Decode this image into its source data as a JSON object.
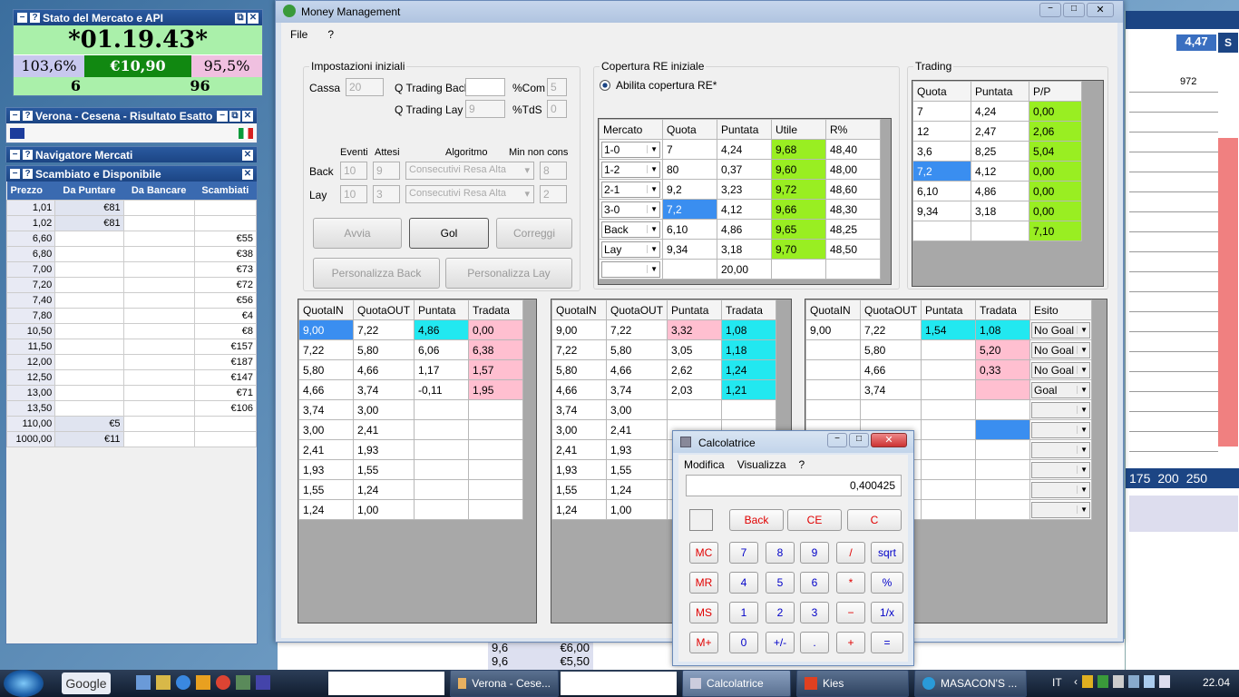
{
  "stato": {
    "title": "Stato del Mercato e API",
    "clock": "*01.19.43*",
    "left": "103,6%",
    "mid": "€10,90",
    "right": "95,5%",
    "n1": "6",
    "n2": "96"
  },
  "verona": {
    "title": "Verona - Cesena - Risultato Esatto"
  },
  "navigatore": {
    "title": "Navigatore Mercati"
  },
  "scambiato": {
    "title": "Scambiato e Disponibile",
    "headers": [
      "Prezzo",
      "Da Puntare",
      "Da Bancare",
      "Scambiati"
    ],
    "rows": [
      [
        "1,01",
        "€81",
        "",
        ""
      ],
      [
        "1,02",
        "€81",
        "",
        ""
      ],
      [
        "6,60",
        "",
        "",
        "€55"
      ],
      [
        "6,80",
        "",
        "",
        "€38"
      ],
      [
        "7,00",
        "",
        "",
        "€73"
      ],
      [
        "7,20",
        "",
        "",
        "€72"
      ],
      [
        "7,40",
        "",
        "",
        "€56"
      ],
      [
        "7,80",
        "",
        "",
        "€4"
      ],
      [
        "10,50",
        "",
        "",
        "€8"
      ],
      [
        "11,50",
        "",
        "",
        "€157"
      ],
      [
        "12,00",
        "",
        "",
        "€187"
      ],
      [
        "12,50",
        "",
        "",
        "€147"
      ],
      [
        "13,00",
        "",
        "",
        "€71"
      ],
      [
        "13,50",
        "",
        "",
        "€106"
      ],
      [
        "110,00",
        "€5",
        "",
        ""
      ],
      [
        "1000,00",
        "€11",
        "",
        ""
      ]
    ]
  },
  "mm": {
    "title": "Money Management",
    "menu": [
      "File",
      "?"
    ],
    "impostazioni": {
      "label": "Impostazioni iniziali",
      "cassa_label": "Cassa",
      "cassa": "20",
      "qtb_label": "Q Trading Back",
      "qtb": "",
      "com_label": "%Com",
      "com": "5",
      "qtl_label": "Q Trading Lay",
      "qtl": "9",
      "tds_label": "%TdS",
      "tds": "0",
      "eventi": "Eventi",
      "attesi": "Attesi",
      "algoritmo": "Algoritmo",
      "minnon": "Min non cons",
      "back": "Back",
      "lay": "Lay",
      "b_ev": "10",
      "b_at": "9",
      "b_alg": "Consecutivi Resa Alta",
      "b_min": "8",
      "l_ev": "10",
      "l_at": "3",
      "l_alg": "Consecutivi Resa Alta",
      "l_min": "2",
      "avvia": "Avvia",
      "gol": "Gol",
      "correggi": "Correggi",
      "pers_back": "Personalizza Back",
      "pers_lay": "Personalizza Lay"
    },
    "copertura": {
      "label": "Copertura RE iniziale",
      "radio": "Abilita copertura RE*",
      "headers": [
        "Mercato",
        "Quota",
        "Puntata",
        "Utile",
        "R%"
      ],
      "rows": [
        [
          "1-0",
          "7",
          "4,24",
          "9,68",
          "48,40"
        ],
        [
          "1-2",
          "80",
          "0,37",
          "9,60",
          "48,00"
        ],
        [
          "2-1",
          "9,2",
          "3,23",
          "9,72",
          "48,60"
        ],
        [
          "3-0",
          "7,2",
          "4,12",
          "9,66",
          "48,30"
        ],
        [
          "Back",
          "6,10",
          "4,86",
          "9,65",
          "48,25"
        ],
        [
          "Lay",
          "9,34",
          "3,18",
          "9,70",
          "48,50"
        ],
        [
          "",
          "",
          "20,00",
          "",
          ""
        ]
      ]
    },
    "trading": {
      "label": "Trading",
      "headers": [
        "Quota",
        "Puntata",
        "P/P"
      ],
      "rows": [
        [
          "7",
          "4,24",
          "0,00"
        ],
        [
          "12",
          "2,47",
          "2,06"
        ],
        [
          "3,6",
          "8,25",
          "5,04"
        ],
        [
          "7,2",
          "4,12",
          "0,00"
        ],
        [
          "6,10",
          "4,86",
          "0,00"
        ],
        [
          "9,34",
          "3,18",
          "0,00"
        ],
        [
          "",
          "",
          "7,10"
        ]
      ]
    },
    "t1": {
      "headers": [
        "QuotaIN",
        "QuotaOUT",
        "Puntata",
        "Tradata"
      ],
      "rows": [
        [
          "9,00",
          "7,22",
          "4,86",
          "0,00"
        ],
        [
          "7,22",
          "5,80",
          "6,06",
          "6,38"
        ],
        [
          "5,80",
          "4,66",
          "1,17",
          "1,57"
        ],
        [
          "4,66",
          "3,74",
          "-0,11",
          "1,95"
        ],
        [
          "3,74",
          "3,00",
          "",
          ""
        ],
        [
          "3,00",
          "2,41",
          "",
          ""
        ],
        [
          "2,41",
          "1,93",
          "",
          ""
        ],
        [
          "1,93",
          "1,55",
          "",
          ""
        ],
        [
          "1,55",
          "1,24",
          "",
          ""
        ],
        [
          "1,24",
          "1,00",
          "",
          ""
        ]
      ]
    },
    "t2": {
      "headers": [
        "QuotaIN",
        "QuotaOUT",
        "Puntata",
        "Tradata"
      ],
      "rows": [
        [
          "9,00",
          "7,22",
          "3,32",
          "1,08"
        ],
        [
          "7,22",
          "5,80",
          "3,05",
          "1,18"
        ],
        [
          "5,80",
          "4,66",
          "2,62",
          "1,24"
        ],
        [
          "4,66",
          "3,74",
          "2,03",
          "1,21"
        ],
        [
          "3,74",
          "3,00",
          "",
          ""
        ],
        [
          "3,00",
          "2,41",
          "",
          ""
        ],
        [
          "2,41",
          "1,93",
          "",
          ""
        ],
        [
          "1,93",
          "1,55",
          "",
          ""
        ],
        [
          "1,55",
          "1,24",
          "",
          ""
        ],
        [
          "1,24",
          "1,00",
          "",
          ""
        ]
      ]
    },
    "t3": {
      "headers": [
        "QuotaIN",
        "QuotaOUT",
        "Puntata",
        "Tradata",
        "Esito"
      ],
      "rows": [
        [
          "9,00",
          "7,22",
          "1,54",
          "1,08",
          "No Goal"
        ],
        [
          "",
          "5,80",
          "",
          "5,20",
          "No Goal"
        ],
        [
          "",
          "4,66",
          "",
          "0,33",
          "No Goal"
        ],
        [
          "",
          "3,74",
          "",
          "",
          "Goal"
        ],
        [
          "",
          "",
          "",
          "",
          ""
        ],
        [
          "",
          "",
          "",
          "",
          ""
        ],
        [
          "",
          "",
          "",
          "",
          ""
        ],
        [
          "",
          "",
          "",
          "",
          ""
        ],
        [
          "",
          "",
          "",
          "",
          ""
        ],
        [
          "",
          "",
          "",
          "",
          ""
        ]
      ]
    }
  },
  "calc": {
    "title": "Calcolatrice",
    "menu": [
      "Modifica",
      "Visualizza",
      "?"
    ],
    "display": "0,400425",
    "back": "Back",
    "ce": "CE",
    "c": "C",
    "rows": [
      [
        "MC",
        "7",
        "8",
        "9",
        "/",
        "sqrt"
      ],
      [
        "MR",
        "4",
        "5",
        "6",
        "*",
        "%"
      ],
      [
        "MS",
        "1",
        "2",
        "3",
        "−",
        "1/x"
      ],
      [
        "M+",
        "0",
        "+/-",
        ".",
        "+",
        "="
      ]
    ]
  },
  "right": {
    "val": "4,47",
    "s": "S",
    "num": "972",
    "scale": [
      "175",
      "200",
      "250"
    ]
  },
  "bg": {
    "r1a": "9,6",
    "r1b": "€5,50",
    "r0a": "9,6",
    "r0b": "€6,00"
  },
  "taskbar": {
    "google": "Google",
    "items": [
      "Verona - Cese...",
      "Calcolatrice",
      "Kies",
      "MASACON'S ..."
    ],
    "lang": "IT",
    "time": "22.04"
  }
}
